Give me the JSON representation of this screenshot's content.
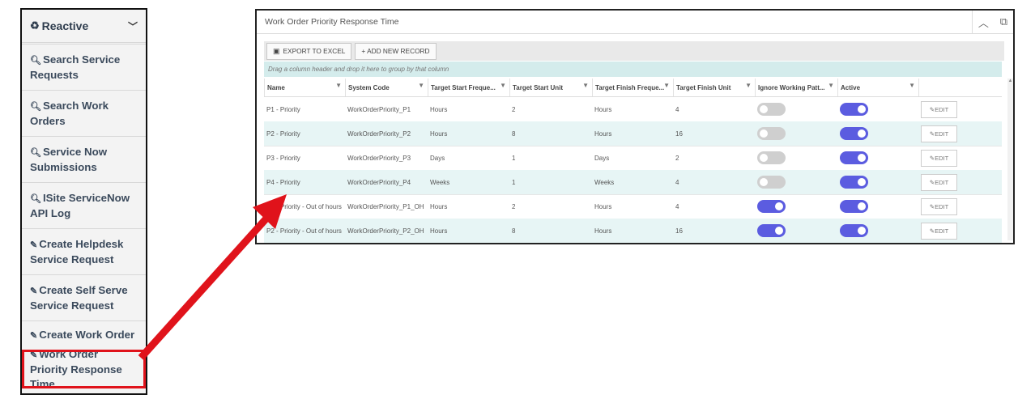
{
  "menu": {
    "header": "Reactive",
    "items": [
      {
        "label": "Search Service Requests",
        "icon": "search-icon"
      },
      {
        "label": "Search Work Orders",
        "icon": "search-icon"
      },
      {
        "label": "Service Now Submissions",
        "icon": "search-icon"
      },
      {
        "label": "ISite ServiceNow API Log",
        "icon": "search-icon"
      },
      {
        "label": "Create Helpdesk Service Request",
        "icon": "edit-icon"
      },
      {
        "label": "Create Self Serve Service Request",
        "icon": "edit-icon"
      },
      {
        "label": "Create Work Order",
        "icon": "edit-icon"
      },
      {
        "label": "Work Order Priority Response Time",
        "icon": "edit-icon"
      }
    ]
  },
  "panel": {
    "title": "Work Order Priority Response Time",
    "toolbar": {
      "export": "EXPORT TO EXCEL",
      "add": "+ ADD NEW RECORD"
    },
    "groupbar": "Drag a column header and drop it here to group by that column",
    "columns": [
      "Name",
      "System Code",
      "Target Start Freque...",
      "Target Start Unit",
      "Target Finish Freque...",
      "Target Finish Unit",
      "Ignore Working Patt...",
      "Active",
      ""
    ],
    "edit_label": "EDIT",
    "rows": [
      {
        "name": "P1 - Priority",
        "code": "WorkOrderPriority_P1",
        "start_freq": "Hours",
        "start_unit": "2",
        "finish_freq": "Hours",
        "finish_unit": "4",
        "ignore": false,
        "active": true
      },
      {
        "name": "P2 - Priority",
        "code": "WorkOrderPriority_P2",
        "start_freq": "Hours",
        "start_unit": "8",
        "finish_freq": "Hours",
        "finish_unit": "16",
        "ignore": false,
        "active": true
      },
      {
        "name": "P3 - Priority",
        "code": "WorkOrderPriority_P3",
        "start_freq": "Days",
        "start_unit": "1",
        "finish_freq": "Days",
        "finish_unit": "2",
        "ignore": false,
        "active": true
      },
      {
        "name": "P4 - Priority",
        "code": "WorkOrderPriority_P4",
        "start_freq": "Weeks",
        "start_unit": "1",
        "finish_freq": "Weeks",
        "finish_unit": "4",
        "ignore": false,
        "active": true
      },
      {
        "name": "P1 - Priority - Out of hours",
        "code": "WorkOrderPriority_P1_OH",
        "start_freq": "Hours",
        "start_unit": "2",
        "finish_freq": "Hours",
        "finish_unit": "4",
        "ignore": true,
        "active": true
      },
      {
        "name": "P2 - Priority - Out of hours",
        "code": "WorkOrderPriority_P2_OH",
        "start_freq": "Hours",
        "start_unit": "8",
        "finish_freq": "Hours",
        "finish_unit": "16",
        "ignore": true,
        "active": true
      }
    ]
  },
  "colors": {
    "highlight": "#e0131b",
    "toggle_on": "#5b5ce0",
    "toggle_off": "#cfcfcf",
    "row_alt": "#e7f5f5"
  }
}
